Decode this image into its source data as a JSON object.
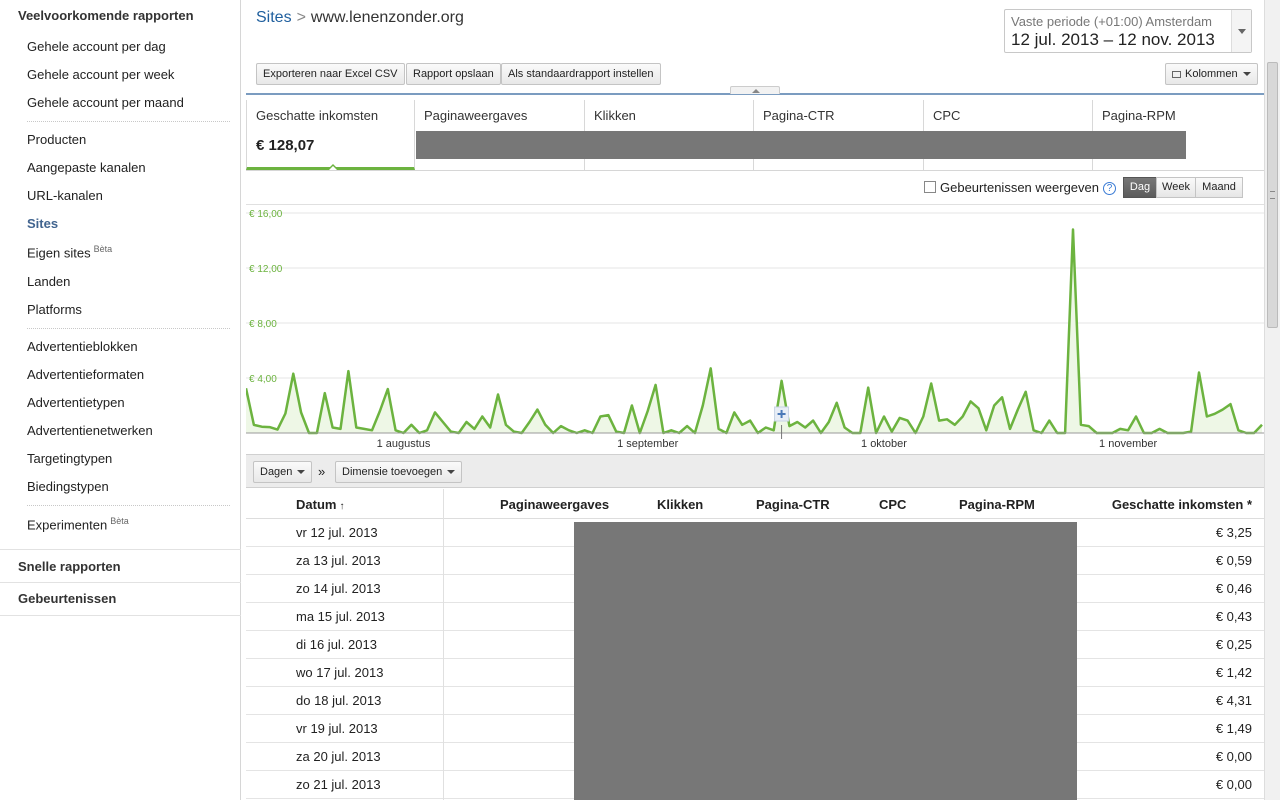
{
  "sidebar": {
    "heading": "Veelvoorkomende rapporten",
    "group1": [
      "Gehele account per dag",
      "Gehele account per week",
      "Gehele account per maand"
    ],
    "group2": [
      "Producten",
      "Aangepaste kanalen",
      "URL-kanalen",
      "Sites",
      "Eigen sites",
      "Landen",
      "Platforms"
    ],
    "group2_active": "Sites",
    "beta": "Bèta",
    "group3": [
      "Advertentieblokken",
      "Advertentieformaten",
      "Advertentietypen",
      "Advertentienetwerken",
      "Targetingtypen",
      "Biedingstypen"
    ],
    "group4": [
      "Experimenten"
    ],
    "quick_reports": "Snelle rapporten",
    "events": "Gebeurtenissen"
  },
  "breadcrumb": {
    "root": "Sites",
    "sep": ">",
    "current": "www.lenenzonder.org"
  },
  "date_range": {
    "label": "Vaste periode (+01:00) Amsterdam",
    "value": "12 jul. 2013 – 12 nov. 2013"
  },
  "toolbar": {
    "export": "Exporteren naar Excel CSV",
    "save": "Rapport opslaan",
    "default": "Als standaardrapport instellen",
    "columns": "Kolommen"
  },
  "metric_tabs": [
    {
      "name": "Geschatte inkomsten",
      "value": "€ 128,07"
    },
    {
      "name": "Paginaweergaves",
      "value": ""
    },
    {
      "name": "Klikken",
      "value": ""
    },
    {
      "name": "Pagina-CTR",
      "value": ""
    },
    {
      "name": "CPC",
      "value": ""
    },
    {
      "name": "Pagina-RPM",
      "value": ""
    }
  ],
  "chart_controls": {
    "events_label": "Gebeurtenissen weergeven",
    "help": "?",
    "granularity": [
      "Dag",
      "Week",
      "Maand"
    ],
    "selected": "Dag"
  },
  "chart_data": {
    "type": "area",
    "ylim": [
      0,
      16
    ],
    "y_ticks": [
      "€ 16,00",
      "€ 12,00",
      "€ 8,00",
      "€ 4,00"
    ],
    "y_tick_values": [
      16,
      12,
      8,
      4
    ],
    "x_ticks": [
      "1 augustus",
      "1 september",
      "1 oktober",
      "1 november"
    ],
    "x_tick_index": [
      20,
      51,
      81,
      112
    ],
    "color": "#6cb33f",
    "x": "12 jul. 2013 – 12 nov. 2013 (daily)",
    "values": [
      3.25,
      0.59,
      0.46,
      0.43,
      0.25,
      1.42,
      4.31,
      1.49,
      0.0,
      0.0,
      2.9,
      0.4,
      0.3,
      4.5,
      0.4,
      0.3,
      0.2,
      1.6,
      3.2,
      0.2,
      0.0,
      0.6,
      0.0,
      0.2,
      1.5,
      0.8,
      0.1,
      0.0,
      0.8,
      0.3,
      1.2,
      0.4,
      2.8,
      0.6,
      0.1,
      0.0,
      0.8,
      1.7,
      0.6,
      0.0,
      0.5,
      0.2,
      0.0,
      0.2,
      0.0,
      1.2,
      1.3,
      0.1,
      0.0,
      2.0,
      0.0,
      1.6,
      3.5,
      0.0,
      0.2,
      0.0,
      0.5,
      0.0,
      2.0,
      4.7,
      0.3,
      0.0,
      1.5,
      0.6,
      0.9,
      0.0,
      0.4,
      0.2,
      3.8,
      0.5,
      0.8,
      0.4,
      0.9,
      0.0,
      0.8,
      2.2,
      0.4,
      0.0,
      0.0,
      3.3,
      0.0,
      1.2,
      0.1,
      1.1,
      0.9,
      0.0,
      1.2,
      3.6,
      0.9,
      1.0,
      0.6,
      1.2,
      2.3,
      1.8,
      0.2,
      2.0,
      2.6,
      0.3,
      1.7,
      3.0,
      0.2,
      0.0,
      0.9,
      0.0,
      0.0,
      14.8,
      0.6,
      0.5,
      0.0,
      0.0,
      0.0,
      0.3,
      0.2,
      1.2,
      0.0,
      0.0,
      0.3,
      0.0,
      0.0,
      0.0,
      0.1,
      4.4,
      1.2,
      1.4,
      1.7,
      2.1,
      0.2,
      0.0,
      0.0,
      0.6
    ]
  },
  "table_controls": {
    "dimension": "Dagen",
    "chevron": "»",
    "add_dimension": "Dimensie toevoegen"
  },
  "table": {
    "headers": [
      "Datum",
      "Paginaweergaves",
      "Klikken",
      "Pagina-CTR",
      "CPC",
      "Pagina-RPM",
      "Geschatte inkomsten *"
    ],
    "sort_indicator": "↑",
    "rows": [
      {
        "date": "vr 12 jul. 2013",
        "earnings": "€ 3,25"
      },
      {
        "date": "za 13 jul. 2013",
        "earnings": "€ 0,59"
      },
      {
        "date": "zo 14 jul. 2013",
        "earnings": "€ 0,46"
      },
      {
        "date": "ma 15 jul. 2013",
        "earnings": "€ 0,43"
      },
      {
        "date": "di 16 jul. 2013",
        "earnings": "€ 0,25"
      },
      {
        "date": "wo 17 jul. 2013",
        "earnings": "€ 1,42"
      },
      {
        "date": "do 18 jul. 2013",
        "earnings": "€ 4,31"
      },
      {
        "date": "vr 19 jul. 2013",
        "earnings": "€ 1,49"
      },
      {
        "date": "za 20 jul. 2013",
        "earnings": "€ 0,00"
      },
      {
        "date": "zo 21 jul. 2013",
        "earnings": "€ 0,00"
      }
    ]
  }
}
